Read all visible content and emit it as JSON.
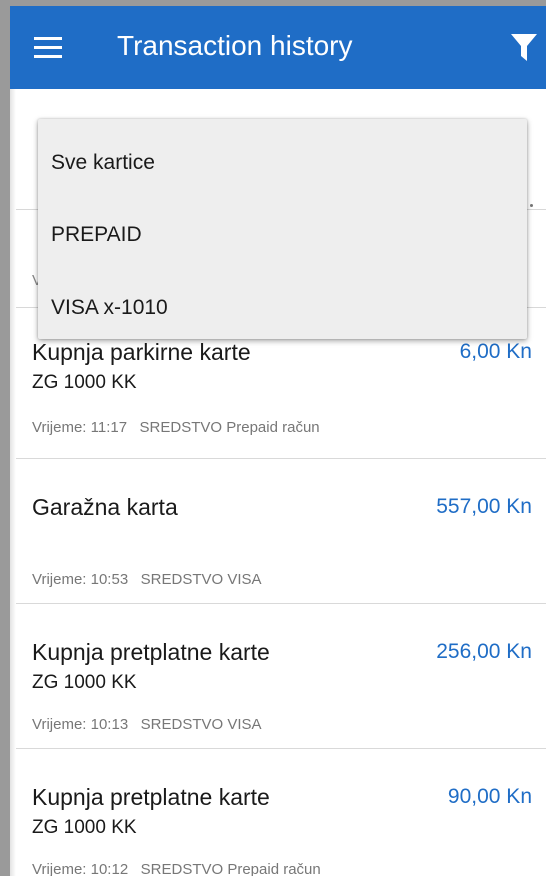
{
  "appbar": {
    "title": "Transaction history",
    "menu_icon": "hamburger-menu-icon",
    "filter_icon": "filter-funnel-icon",
    "color": "#1f6dc6"
  },
  "dropdown": {
    "options": [
      "Sve kartice",
      "PREPAID",
      "VISA x-1010"
    ]
  },
  "background_peek": {
    "partial_text": "V"
  },
  "transactions": [
    {
      "name": "Kupnja parkirne karte",
      "sub": "ZG 1000 KK",
      "amount": "6,00 Kn",
      "meta": "Vrijeme: 11:17   SREDSTVO Prepaid račun"
    },
    {
      "name": "Garažna karta",
      "sub": "",
      "amount": "557,00 Kn",
      "meta": "Vrijeme: 10:53   SREDSTVO VISA"
    },
    {
      "name": "Kupnja pretplatne karte",
      "sub": "ZG 1000 KK",
      "amount": "256,00 Kn",
      "meta": "Vrijeme: 10:13   SREDSTVO VISA"
    },
    {
      "name": "Kupnja pretplatne karte",
      "sub": "ZG 1000 KK",
      "amount": "90,00 Kn",
      "meta": "Vrijeme: 10:12   SREDSTVO Prepaid račun"
    }
  ]
}
